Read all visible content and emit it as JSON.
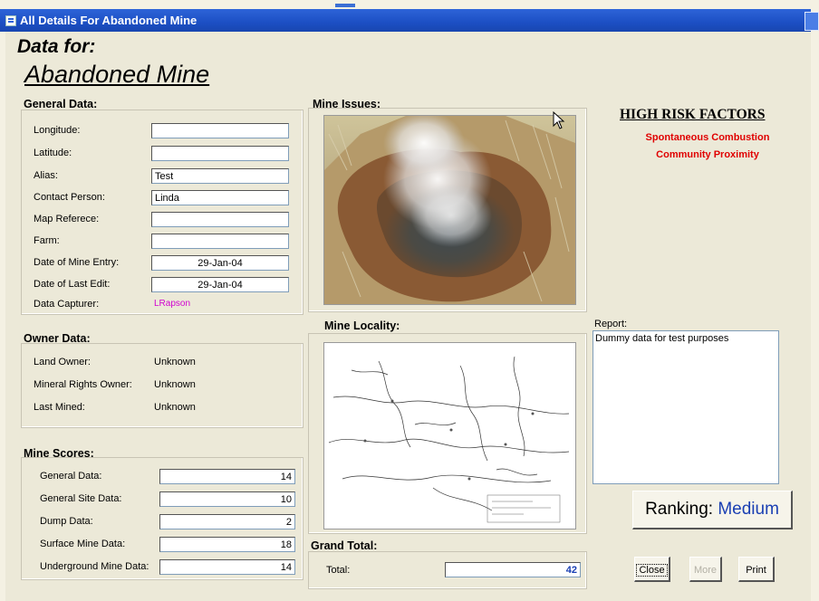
{
  "window": {
    "title": "All Details For Abandoned Mine"
  },
  "header": {
    "data_for": "Data for:",
    "mine_name": "Abandoned Mine"
  },
  "general": {
    "title": "General Data:",
    "fields": [
      {
        "label": "Longitude:",
        "value": ""
      },
      {
        "label": "Latitude:",
        "value": ""
      },
      {
        "label": "Alias:",
        "value": "Test"
      },
      {
        "label": "Contact Person:",
        "value": "Linda"
      },
      {
        "label": "Map Referece:",
        "value": ""
      },
      {
        "label": "Farm:",
        "value": ""
      },
      {
        "label": "Date of Mine Entry:",
        "value": "29-Jan-04"
      },
      {
        "label": "Date of Last Edit:",
        "value": "29-Jan-04"
      }
    ],
    "capturer_label": "Data Capturer:",
    "capturer_value": "LRapson"
  },
  "owner": {
    "title": "Owner Data:",
    "rows": [
      {
        "label": "Land Owner:",
        "value": "Unknown"
      },
      {
        "label": "Mineral Rights Owner:",
        "value": "Unknown"
      },
      {
        "label": "Last Mined:",
        "value": "Unknown"
      }
    ]
  },
  "scores": {
    "title": "Mine Scores:",
    "rows": [
      {
        "label": "General Data:",
        "value": "14"
      },
      {
        "label": "General Site Data:",
        "value": "10"
      },
      {
        "label": "Dump Data:",
        "value": "2"
      },
      {
        "label": "Surface Mine Data:",
        "value": "18"
      },
      {
        "label": "Underground Mine Data:",
        "value": "14"
      }
    ]
  },
  "issues": {
    "title": "Mine Issues:"
  },
  "locality": {
    "title": "Mine Locality:"
  },
  "grand": {
    "title": "Grand Total:",
    "label": "Total:",
    "value": "42"
  },
  "risk": {
    "title": "HIGH RISK FACTORS",
    "items": [
      "Spontaneous Combustion",
      "Community Proximity"
    ]
  },
  "report": {
    "label": "Report:",
    "text": "Dummy data for test purposes"
  },
  "ranking": {
    "label": "Ranking:",
    "value": "Medium"
  },
  "buttons": {
    "close": "Close",
    "more": "More",
    "print": "Print"
  },
  "colors": {
    "title_bar": "#1c4fc4",
    "risk_text": "#e00000",
    "capturer": "#d000d0",
    "total_value": "#1a3fb3"
  }
}
